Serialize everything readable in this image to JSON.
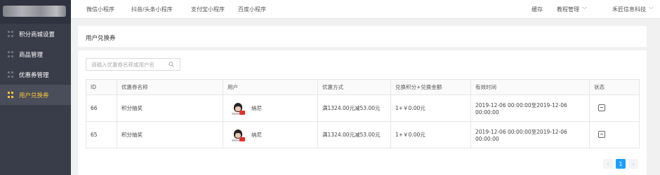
{
  "sidebar": {
    "items": [
      {
        "label": "积分商城设置",
        "active": false
      },
      {
        "label": "商品管理",
        "active": false
      },
      {
        "label": "优惠券管理",
        "active": false
      },
      {
        "label": "用户兑换券",
        "active": true
      }
    ]
  },
  "topbar": {
    "tabs": [
      "微信小程序",
      "抖音/头条小程序",
      "支付宝小程序",
      "百度小程序"
    ],
    "cache": "缓存",
    "tutorial": "教程管理",
    "company": "禾匠信息科技"
  },
  "page": {
    "title": "用户兑换券"
  },
  "search": {
    "placeholder": "请输入优惠券名称或用户名",
    "value": ""
  },
  "table": {
    "headers": [
      "ID",
      "优惠券名称",
      "用户",
      "优惠方式",
      "兑换积分+兑换金额",
      "有效时间",
      "状态"
    ],
    "rows": [
      {
        "id": "66",
        "coupon": "积分抽奖",
        "user": "纳尼",
        "discount": "满1324.00元减53.00元",
        "exchange": "1+￥0.00元",
        "valid": "2019-12-06 00:00:00至2019-12-06 00:00:00"
      },
      {
        "id": "65",
        "coupon": "积分抽奖",
        "user": "纳尼",
        "discount": "满1324.00元减53.00元",
        "exchange": "1+￥0.00元",
        "valid": "2019-12-06 00:00:00至2019-12-06 00:00:00"
      }
    ]
  },
  "pagination": {
    "prev": "‹",
    "current": "1",
    "next": "›"
  },
  "colors": {
    "sidebar_bg": "#393d49",
    "active_accent": "#f7c33a",
    "primary_blue": "#1e9fff"
  }
}
